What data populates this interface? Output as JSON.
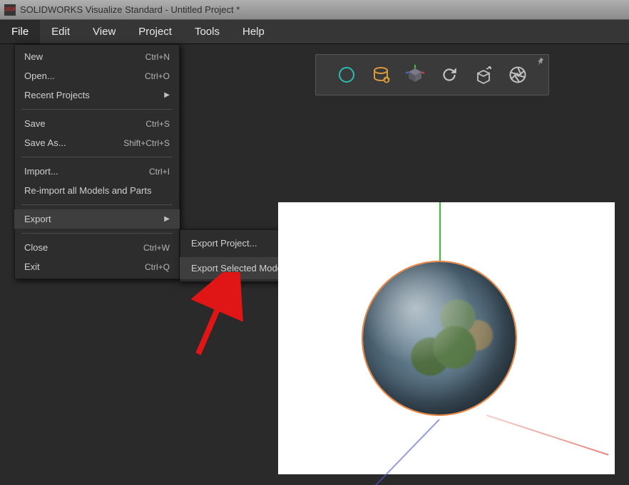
{
  "titlebar": {
    "title": "SOLIDWORKS Visualize Standard - Untitled Project *"
  },
  "menubar": {
    "items": [
      {
        "label": "File"
      },
      {
        "label": "Edit"
      },
      {
        "label": "View"
      },
      {
        "label": "Project"
      },
      {
        "label": "Tools"
      },
      {
        "label": "Help"
      }
    ]
  },
  "file_menu": {
    "group1": [
      {
        "label": "New",
        "shortcut": "Ctrl+N"
      },
      {
        "label": "Open...",
        "shortcut": "Ctrl+O"
      },
      {
        "label": "Recent Projects",
        "submenu": true
      }
    ],
    "group2": [
      {
        "label": "Save",
        "shortcut": "Ctrl+S"
      },
      {
        "label": "Save As...",
        "shortcut": "Shift+Ctrl+S"
      }
    ],
    "group3": [
      {
        "label": "Import...",
        "shortcut": "Ctrl+I"
      },
      {
        "label": "Re-import all Models and Parts"
      }
    ],
    "group4": [
      {
        "label": "Export",
        "submenu": true
      }
    ],
    "group5": [
      {
        "label": "Close",
        "shortcut": "Ctrl+W"
      },
      {
        "label": "Exit",
        "shortcut": "Ctrl+Q"
      }
    ]
  },
  "export_submenu": {
    "items": [
      {
        "label": "Export Project..."
      },
      {
        "label": "Export Selected Models and Parts..."
      }
    ]
  },
  "toolbar": {
    "icons": [
      {
        "name": "select-sphere-icon",
        "tint": "#2dbdb0"
      },
      {
        "name": "database-icon",
        "tint": "#d89a3b"
      },
      {
        "name": "cube-gizmo-icon"
      },
      {
        "name": "refresh-icon",
        "tint": "#bdbdbd"
      },
      {
        "name": "open-box-icon",
        "tint": "#bdbdbd"
      },
      {
        "name": "aperture-icon",
        "tint": "#bdbdbd"
      }
    ]
  },
  "viewport": {
    "selected_object": "globe-sphere"
  }
}
